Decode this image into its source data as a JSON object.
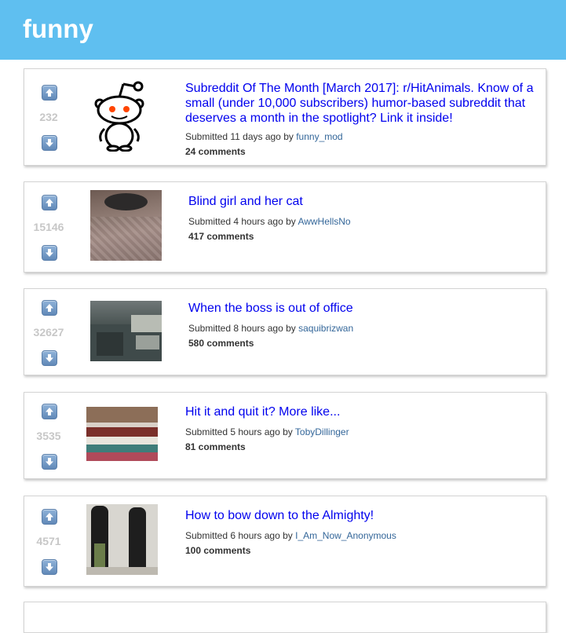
{
  "header": {
    "title": "funny"
  },
  "colors": {
    "header_bg": "#5fbff0",
    "link": "#0000ee",
    "author": "#336699",
    "score": "#c7c7c7"
  },
  "posts": [
    {
      "score": "232",
      "title": "Subreddit Of The Month [March 2017]: r/HitAnimals. Know of a small (under 10,000 subscribers) humor-based subreddit that deserves a month in the spotlight? Link it inside!",
      "submitted_prefix": "Submitted 11 days ago by",
      "author": "funny_mod",
      "comments": "24 comments",
      "thumbnail": "reddit-alien-icon"
    },
    {
      "score": "15146",
      "title": "Blind girl and her cat",
      "submitted_prefix": "Submitted 4 hours ago by",
      "author": "AwwHellsNo",
      "comments": "417 comments",
      "thumbnail": "cat-on-bed-photo"
    },
    {
      "score": "32627",
      "title": "When the boss is out of office",
      "submitted_prefix": "Submitted 8 hours ago by",
      "author": "saquibrizwan",
      "comments": "580 comments",
      "thumbnail": "office-cctv-photo"
    },
    {
      "score": "3535",
      "title": "Hit it and quit it? More like...",
      "submitted_prefix": "Submitted 5 hours ago by",
      "author": "TobyDillinger",
      "comments": "81 comments",
      "thumbnail": "book-stack-photo"
    },
    {
      "score": "4571",
      "title": "How to bow down to the Almighty!",
      "submitted_prefix": "Submitted 6 hours ago by",
      "author": "I_Am_Now_Anonymous",
      "comments": "100 comments",
      "thumbnail": "two-people-photo"
    }
  ]
}
